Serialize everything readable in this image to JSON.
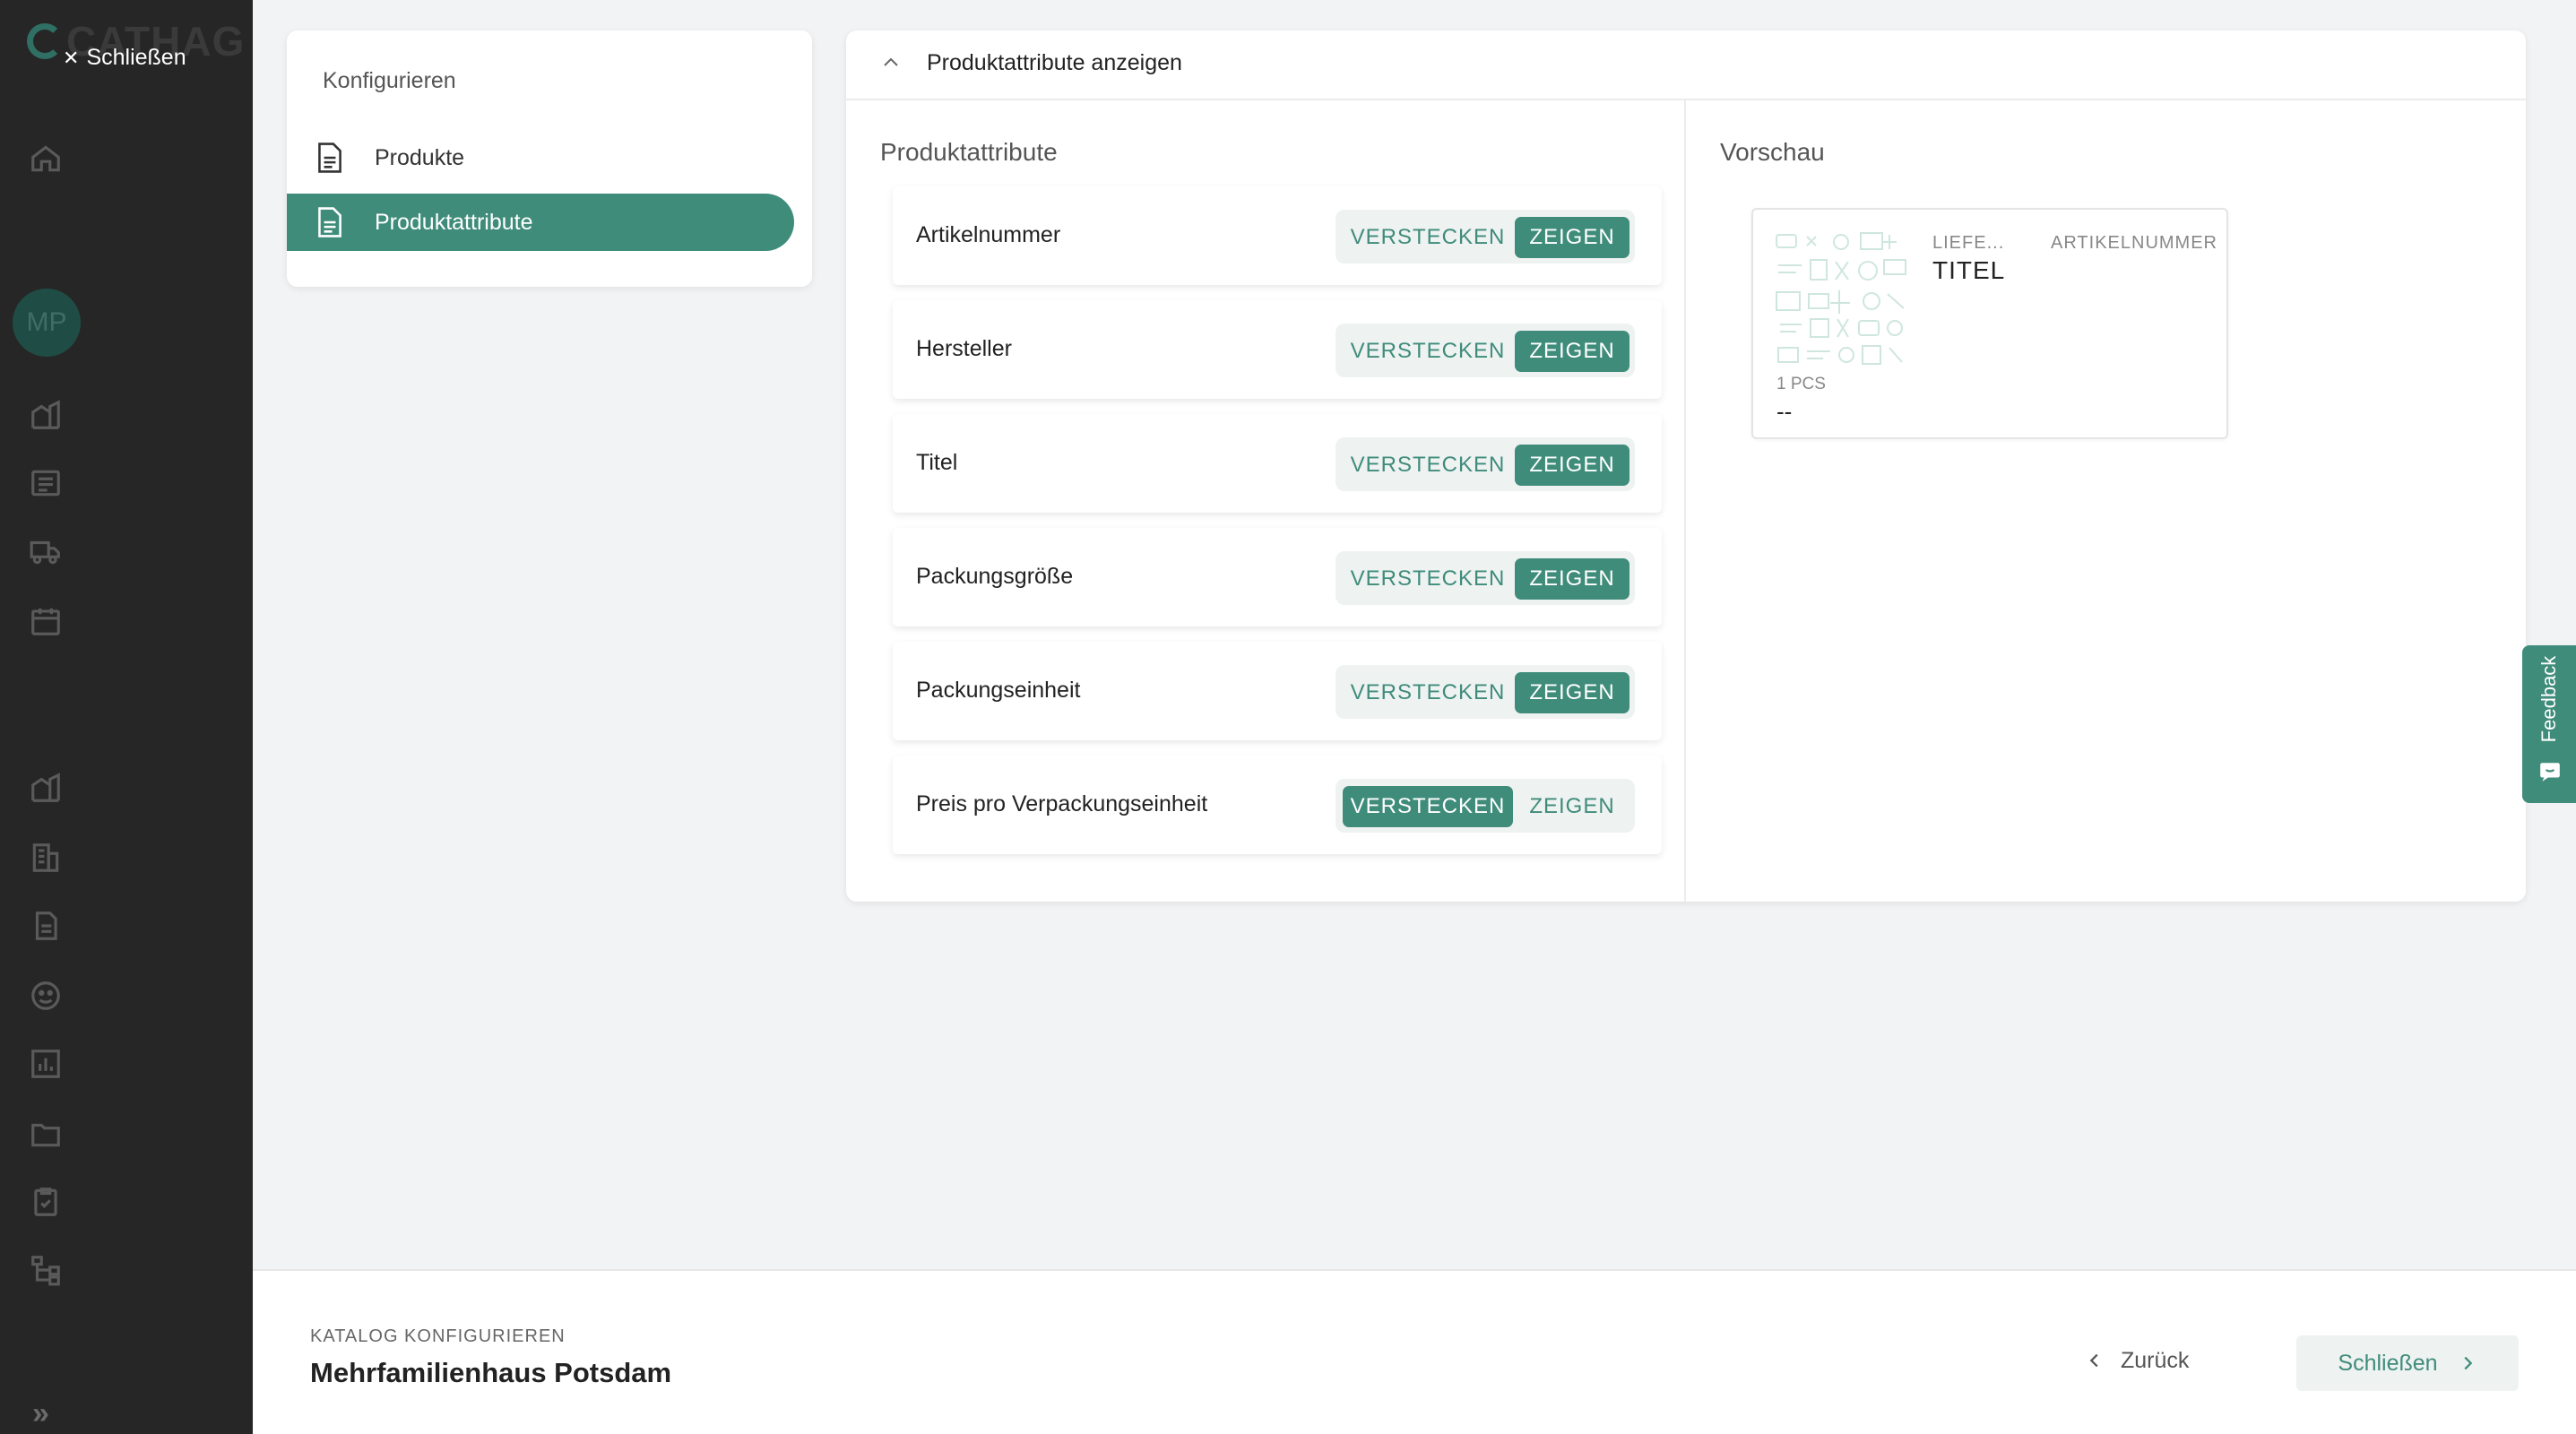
{
  "sidebar": {
    "brand": "CATHAG",
    "close_label": "Schließen",
    "avatar_initials": "MP",
    "expand_symbol": "»",
    "icons": [
      "home-icon",
      "building-icon",
      "list-icon",
      "truck-icon",
      "calendar-icon",
      "building-2-icon",
      "office-icon",
      "document-icon",
      "face-icon",
      "chart-icon",
      "folder-icon",
      "clipboard-icon",
      "hierarchy-icon"
    ]
  },
  "config": {
    "title": "Konfigurieren",
    "items": [
      {
        "label": "Produkte",
        "active": false
      },
      {
        "label": "Produktattribute",
        "active": true
      }
    ]
  },
  "panel": {
    "header_title": "Produktattribute anzeigen",
    "attributes_title": "Produktattribute",
    "preview_title": "Vorschau",
    "hide_label": "VERSTECKEN",
    "show_label": "ZEIGEN",
    "attributes": [
      {
        "label": "Artikelnummer",
        "selected": "show"
      },
      {
        "label": "Hersteller",
        "selected": "show"
      },
      {
        "label": "Titel",
        "selected": "show"
      },
      {
        "label": "Packungsgröße",
        "selected": "show"
      },
      {
        "label": "Packungseinheit",
        "selected": "show"
      },
      {
        "label": "Preis pro Verpackungseinheit",
        "selected": "hide"
      }
    ]
  },
  "preview": {
    "supplier": "LIEFE...",
    "article_number": "ARTIKELNUMMER",
    "title": "TITEL",
    "pack": "1 PCS",
    "price": "--"
  },
  "feedback_label": "Feedback",
  "bottom": {
    "subtitle": "KATALOG KONFIGURIEREN",
    "title": "Mehrfamilienhaus Potsdam",
    "back_label": "Zurück",
    "next_label": "Schließen"
  },
  "colors": {
    "accent": "#3f8c7b",
    "sidebar_bg": "#262626",
    "toggle_bg": "#eef2f1"
  }
}
